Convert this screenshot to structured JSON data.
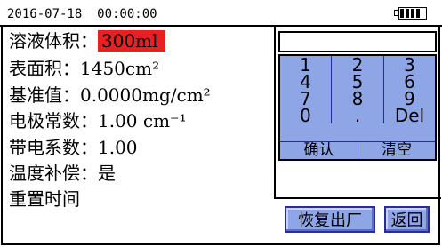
{
  "status": {
    "datetime": "2016-07-18  00:00:00",
    "battery_level": 1.0
  },
  "params": [
    {
      "label": "溶液体积：",
      "value": "300ml",
      "selected": true
    },
    {
      "label": "表面积：",
      "value": "1450cm²"
    },
    {
      "label": "基准值：",
      "value": "0.0000mg/cm²"
    },
    {
      "label": "电极常数：",
      "value": "1.00 cm⁻¹"
    },
    {
      "label": "带电系数：",
      "value": "1.00"
    },
    {
      "label": "温度补偿：",
      "value": "是"
    },
    {
      "label": "重置时间",
      "value": ""
    }
  ],
  "keypad": {
    "display_value": "",
    "keys": [
      "1",
      "2",
      "3",
      "4",
      "5",
      "6",
      "7",
      "8",
      "9",
      "0",
      ".",
      "Del"
    ],
    "confirm_label": "确认",
    "clear_label": "清空"
  },
  "buttons": {
    "factory_reset_label": "恢复出厂",
    "back_label": "返回"
  },
  "colors": {
    "selected_highlight": "#e82020",
    "keypad_fill": "#8fa6e6",
    "keypad_lines": "#2b2b9a"
  }
}
